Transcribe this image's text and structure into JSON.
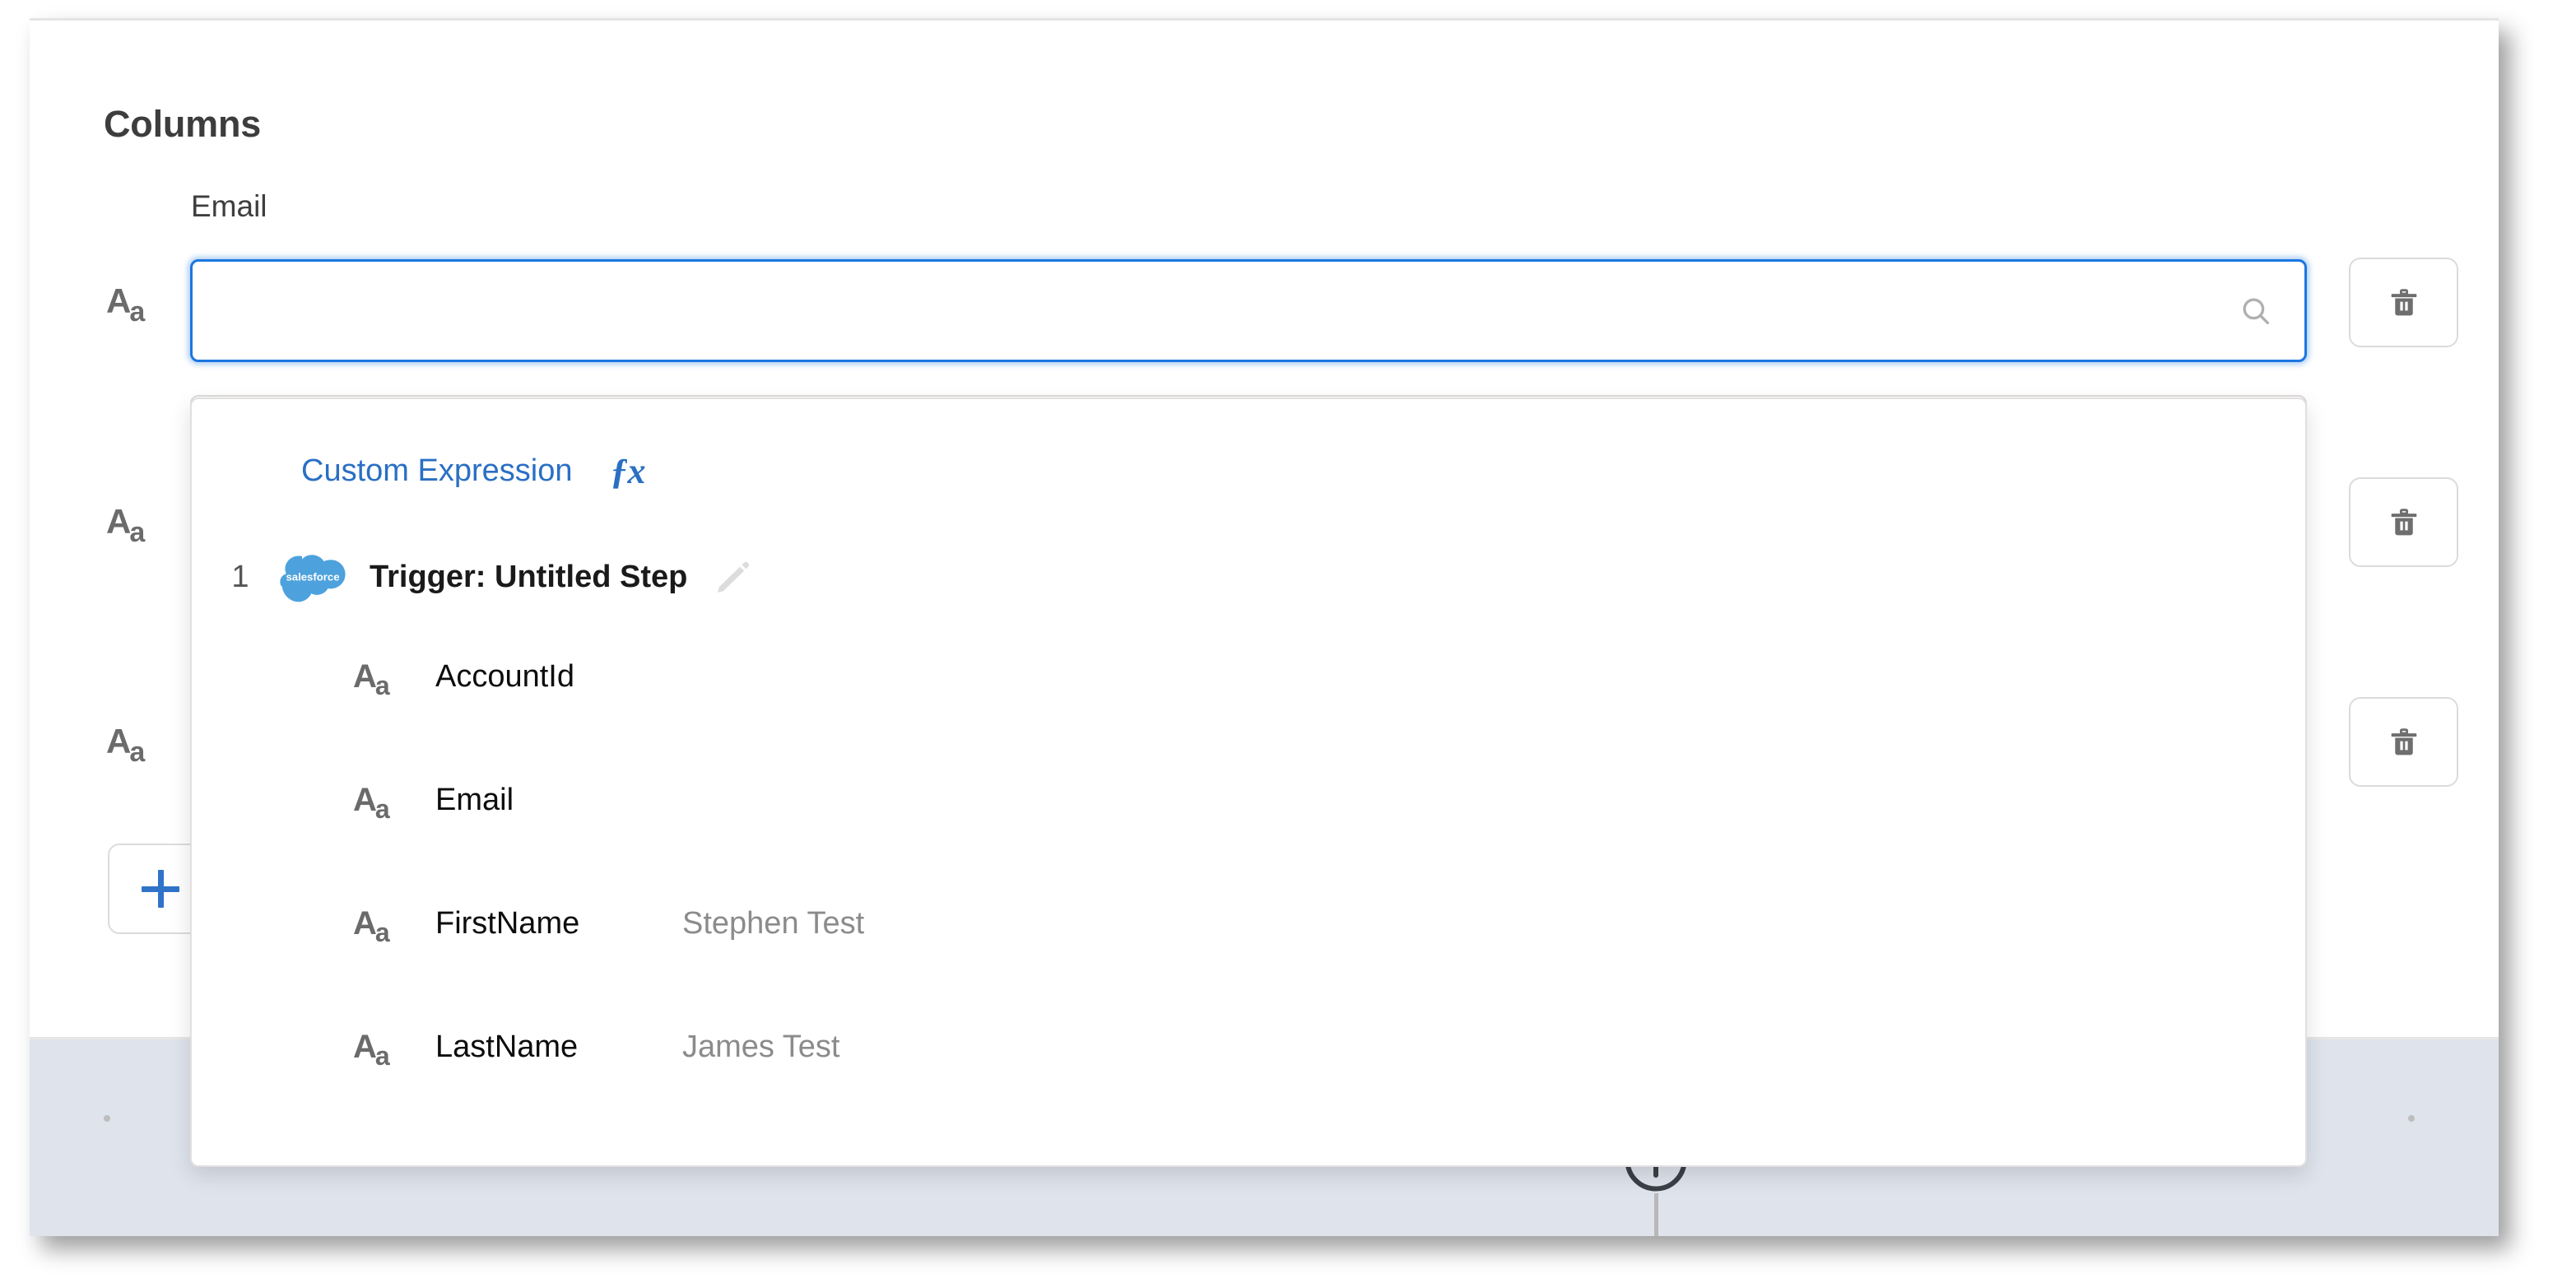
{
  "panel": {
    "title": "Columns"
  },
  "columns": [
    {
      "label": "Email",
      "type_glyph": "Aa",
      "input_value": "",
      "input_placeholder": "",
      "focused": true,
      "search_icon": "search-icon",
      "delete_icon": "trash-icon"
    },
    {
      "label": "",
      "type_glyph": "Aa",
      "input_value": "",
      "input_placeholder": "",
      "focused": false,
      "delete_icon": "trash-icon"
    },
    {
      "label": "",
      "type_glyph": "Aa",
      "input_value": "",
      "input_placeholder": "",
      "focused": false,
      "delete_icon": "trash-icon"
    }
  ],
  "add_column_button": {
    "icon": "plus-icon",
    "label": ""
  },
  "dropdown": {
    "custom_expression": {
      "label": "Custom Expression",
      "icon": "fx-icon",
      "icon_text": "ƒx"
    },
    "group": {
      "index": "1",
      "logo": "salesforce-cloud-icon",
      "logo_text": "salesforce",
      "title": "Trigger: Untitled Step",
      "edit_icon": "pencil-icon"
    },
    "options": [
      {
        "glyph": "Aa",
        "name": "AccountId",
        "value": ""
      },
      {
        "glyph": "Aa",
        "name": "Email",
        "value": ""
      },
      {
        "glyph": "Aa",
        "name": "FirstName",
        "value": "Stephen Test"
      },
      {
        "glyph": "Aa",
        "name": "LastName",
        "value": "James Test"
      }
    ]
  },
  "canvas": {
    "add_node_icon": "circle-plus-icon"
  },
  "colors": {
    "accent_blue": "#1b76e0",
    "link_blue": "#2a6fc4",
    "salesforce_blue": "#4da2dd",
    "border_grey": "#dddbda",
    "canvas_lavender": "#dfe3ec",
    "muted_text": "#8b8b8b"
  }
}
